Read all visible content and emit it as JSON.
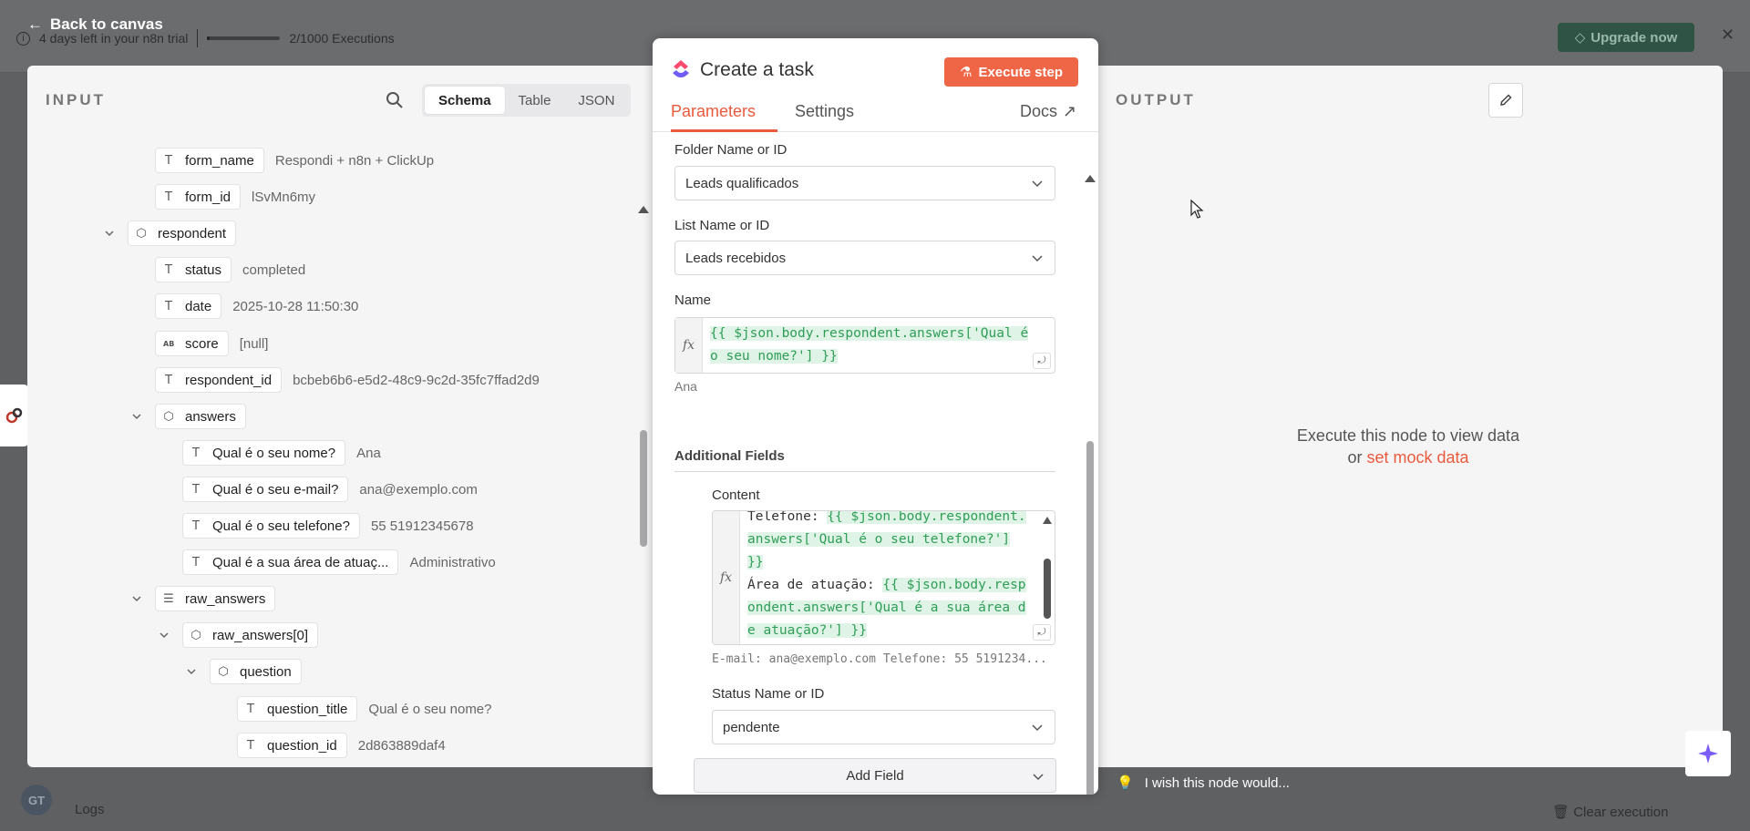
{
  "background": {
    "trial_text": "4 days left in your n8n trial",
    "executions_text": "2/1000 Executions",
    "executions_progress": 0.002,
    "upgrade_label": "Upgrade now",
    "back_label": "Back to canvas",
    "logs_label": "Logs",
    "clear_label": "Clear execution",
    "avatar_initials": "GT",
    "wish_text": "I wish this node would..."
  },
  "input": {
    "title": "INPUT",
    "tabs": [
      "Schema",
      "Table",
      "JSON"
    ],
    "active_tab": "Schema",
    "rows": [
      {
        "indent": 0,
        "key": "form_name",
        "type": "T",
        "value": "Respondi + n8n + ClickUp"
      },
      {
        "indent": 0,
        "key": "form_id",
        "type": "T",
        "value": "lSvMn6my"
      },
      {
        "indent": -1,
        "key": "respondent",
        "type": "obj",
        "value": "",
        "expand": true
      },
      {
        "indent": 0,
        "key": "status",
        "type": "T",
        "value": "completed"
      },
      {
        "indent": 0,
        "key": "date",
        "type": "T",
        "value": "2025-10-28 11:50:30"
      },
      {
        "indent": 0,
        "key": "score",
        "type": "AB",
        "value": "[null]"
      },
      {
        "indent": 0,
        "key": "respondent_id",
        "type": "T",
        "value": "bcbeb6b6-e5d2-48c9-9c2d-35fc7ffad2d9"
      },
      {
        "indent": 0,
        "key": "answers",
        "type": "obj",
        "value": "",
        "expand": true
      },
      {
        "indent": 1,
        "key": "Qual é o seu nome?",
        "type": "T",
        "value": "Ana"
      },
      {
        "indent": 1,
        "key": "Qual é o seu e-mail?",
        "type": "T",
        "value": "ana@exemplo.com"
      },
      {
        "indent": 1,
        "key": "Qual é o seu telefone?",
        "type": "T",
        "value": "55 51912345678"
      },
      {
        "indent": 1,
        "key": "Qual é a sua área de atuaç...",
        "type": "T",
        "value": "Administrativo"
      },
      {
        "indent": 0,
        "key": "raw_answers",
        "type": "list",
        "value": "",
        "expand": true
      },
      {
        "indent": 1,
        "key": "raw_answers[0]",
        "type": "obj",
        "value": "",
        "expand": true
      },
      {
        "indent": 2,
        "key": "question",
        "type": "obj",
        "value": "",
        "expand": true
      },
      {
        "indent": 3,
        "key": "question_title",
        "type": "T",
        "value": "Qual é o seu nome?"
      },
      {
        "indent": 3,
        "key": "question_id",
        "type": "T",
        "value": "2d863889daf4"
      }
    ]
  },
  "node": {
    "title": "Create a task",
    "execute_label": "Execute step",
    "tabs": {
      "parameters": "Parameters",
      "settings": "Settings",
      "docs": "Docs"
    },
    "folder": {
      "label": "Folder Name or ID",
      "value": "Leads qualificados"
    },
    "list": {
      "label": "List Name or ID",
      "value": "Leads recebidos"
    },
    "name": {
      "label": "Name",
      "line1": "{{ $json.body.respondent.answers['Qual é",
      "line2": "o seu nome?'] }}",
      "preview": "Ana"
    },
    "additional_label": "Additional Fields",
    "content": {
      "label": "Content",
      "l1_plain": "Telefone: ",
      "l1_hl": "{{ $json.body.respondent.",
      "l2_hl": "answers['Qual é o seu telefone?']",
      "l3_hl": "}}",
      "l4_plain": "Área de atuação: ",
      "l4_hl": "{{ $json.body.resp",
      "l5_hl": "ondent.answers['Qual é a sua área d",
      "l6_hl": "e atuação?'] }}",
      "preview": "E-mail: ana@exemplo.com Telefone: 55 5191234..."
    },
    "status": {
      "label": "Status Name or ID",
      "value": "pendente"
    },
    "add_field_label": "Add Field"
  },
  "output": {
    "title": "OUTPUT",
    "msg_line1": "Execute this node to view data",
    "msg_or": "or ",
    "msg_link": "set mock data"
  },
  "colors": {
    "accent": "#ea5a3d",
    "expr_green": "#2f9e57",
    "upgrade_bg": "#2f5446"
  }
}
